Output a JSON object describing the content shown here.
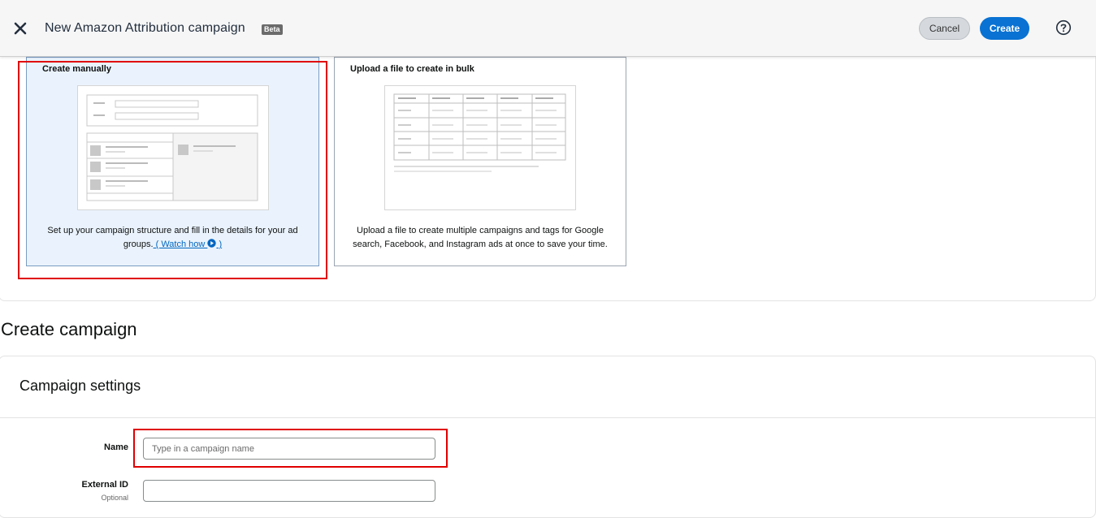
{
  "header": {
    "title": "New Amazon Attribution campaign",
    "badge": "Beta",
    "cancel_label": "Cancel",
    "create_label": "Create",
    "close_icon": "close-icon",
    "help_icon": "help-icon"
  },
  "methods": {
    "manual": {
      "title": "Create manually",
      "description": "Set up your campaign structure and fill in the details for your ad groups.",
      "link_label": " ( Watch how ",
      "link_close": " )",
      "play_icon": "play-circle-icon"
    },
    "bulk": {
      "title": "Upload a file to create in bulk",
      "description": "Upload a file to create multiple campaigns and tags for Google search, Facebook, and Instagram ads at once to save your time."
    }
  },
  "main": {
    "heading": "Create campaign"
  },
  "settings": {
    "title": "Campaign settings",
    "name_label": "Name",
    "name_placeholder": "Type in a campaign name",
    "name_value": "",
    "external_id_label": "External ID",
    "external_id_sub": "Optional",
    "external_id_value": ""
  },
  "colors": {
    "accent": "#0972d3",
    "highlight": "#e00000",
    "selected_card_bg": "#eaf3fd"
  }
}
